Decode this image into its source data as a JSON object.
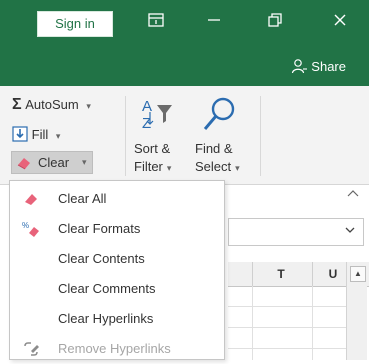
{
  "titlebar": {
    "signin_label": "Sign in",
    "icons": [
      "ribbon-display-icon",
      "minimize-icon",
      "restore-icon",
      "close-icon"
    ],
    "share_label": "Share"
  },
  "ribbon": {
    "autosum_label": "AutoSum",
    "fill_label": "Fill",
    "clear_label": "Clear",
    "sort_label_1": "Sort &",
    "sort_label_2": "Filter",
    "find_label_1": "Find &",
    "find_label_2": "Select",
    "dropdown_arrow": "▾"
  },
  "grid": {
    "columns": [
      "T",
      "U"
    ]
  },
  "clear_menu": {
    "items": [
      {
        "label": "Clear All",
        "icon": "eraser-icon",
        "enabled": true
      },
      {
        "label": "Clear Formats",
        "icon": "clear-formats-icon",
        "enabled": true
      },
      {
        "label": "Clear Contents",
        "icon": "",
        "enabled": true
      },
      {
        "label": "Clear Comments",
        "icon": "",
        "enabled": true
      },
      {
        "label": "Clear Hyperlinks",
        "icon": "",
        "enabled": true
      },
      {
        "label": "Remove Hyperlinks",
        "icon": "remove-hyperlinks-icon",
        "enabled": false
      }
    ]
  },
  "colors": {
    "accent": "#217346",
    "eraser": "#e8637a",
    "disabled_text": "#a6a6a6"
  }
}
